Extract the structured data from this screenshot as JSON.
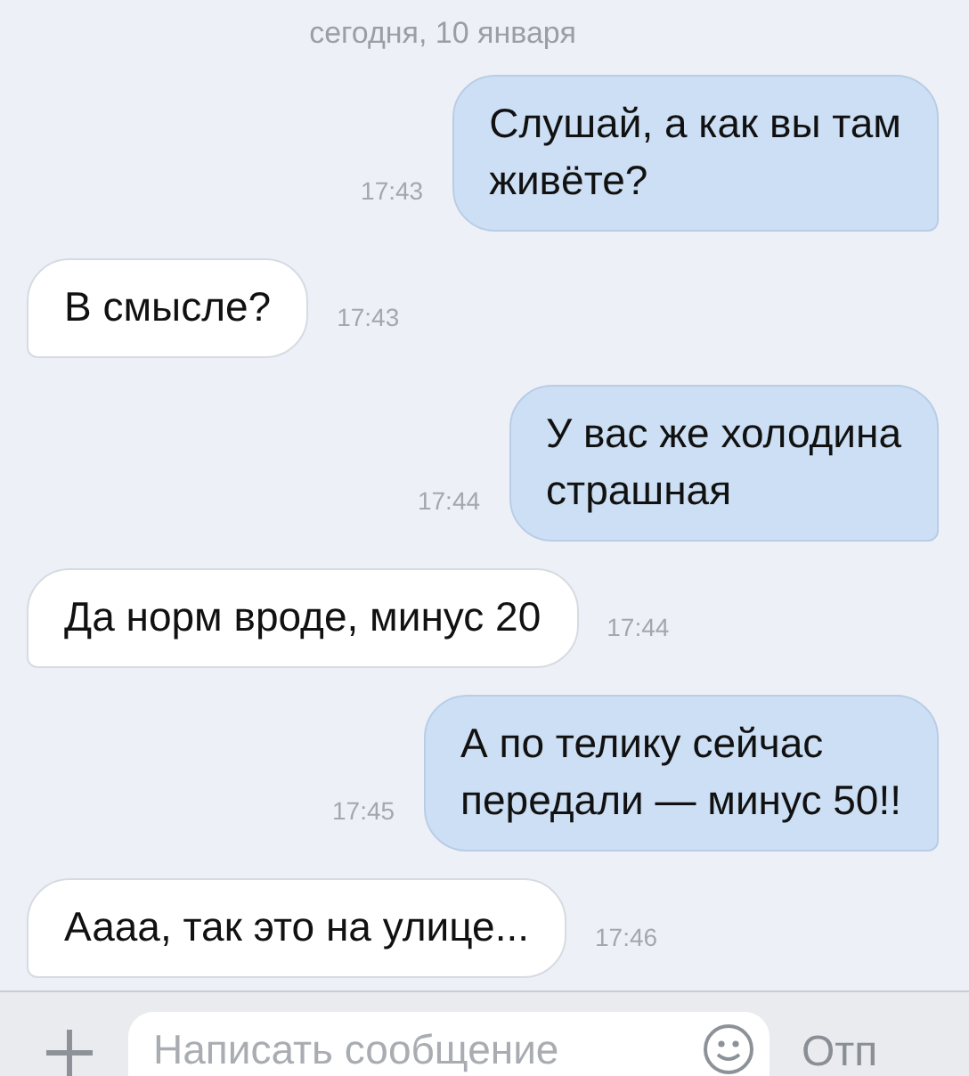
{
  "date_header": "сегодня, 10 января",
  "messages": [
    {
      "kind": "out",
      "text": "Слушай, а как вы там\nживёте?",
      "time": "17:43"
    },
    {
      "kind": "in",
      "text": "В смысле?",
      "time": "17:43"
    },
    {
      "kind": "out",
      "text": "У вас же холодина\nстрашная",
      "time": "17:44"
    },
    {
      "kind": "in",
      "text": "Да норм вроде, минус 20",
      "time": "17:44"
    },
    {
      "kind": "out",
      "text": "А по телику сейчас\nпередали — минус 50!!",
      "time": "17:45"
    },
    {
      "kind": "in",
      "text": "Аааа, так это на улице...",
      "time": "17:46"
    }
  ],
  "composer": {
    "placeholder": "Написать сообщение",
    "send_label": "Отп"
  }
}
